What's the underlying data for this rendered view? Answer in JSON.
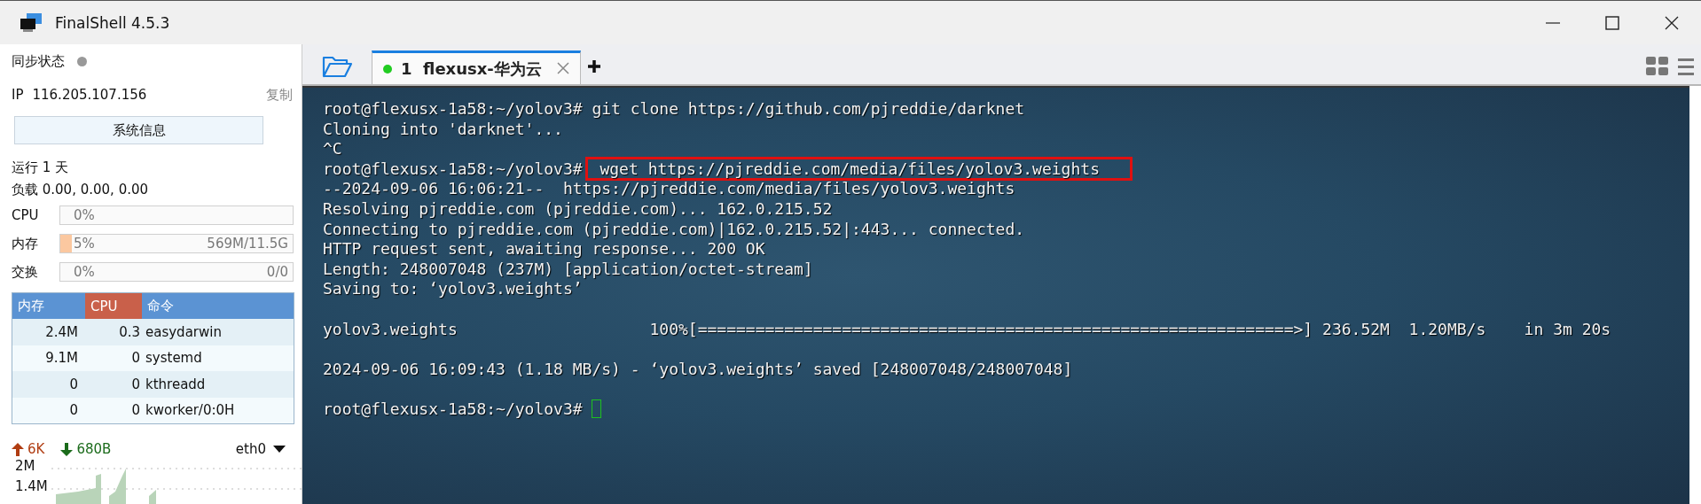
{
  "window": {
    "title": "FinalShell 4.5.3"
  },
  "sidebar": {
    "sync_label": "同步状态",
    "ip_label": "IP",
    "ip": "116.205.107.156",
    "copy_link": "复制",
    "sysinfo_button": "系统信息",
    "uptime": "运行 1 天",
    "load": "负载 0.00, 0.00, 0.00",
    "meters": [
      {
        "label": "CPU",
        "reading": "0%",
        "level": 0
      },
      {
        "label": "内存",
        "reading": "5%",
        "detail": "569M/11.5G",
        "level": 0.05
      },
      {
        "label": "交换",
        "reading": "0%",
        "detail": "0/0",
        "level": 0
      }
    ],
    "process_table": {
      "columns": [
        {
          "label": "内存",
          "selected": false
        },
        {
          "label": "CPU",
          "selected": true
        },
        {
          "label": "命令",
          "selected": false
        }
      ],
      "rows": [
        {
          "mem": "2.4M",
          "cpu": "0.3",
          "command": "easydarwin"
        },
        {
          "mem": "9.1M",
          "cpu": "0",
          "command": "systemd"
        },
        {
          "mem": "0",
          "cpu": "0",
          "command": "kthreadd"
        },
        {
          "mem": "0",
          "cpu": "0",
          "command": "kworker/0:0H"
        }
      ]
    },
    "network": {
      "upload": "6K",
      "download": "680B",
      "interface": "eth0",
      "axis_labels": [
        "2M",
        "1.4M"
      ]
    }
  },
  "tabs": [
    {
      "label": "1  flexusx-华为云",
      "connected": true,
      "selected": true
    }
  ],
  "terminal": {
    "lines": [
      {
        "kind": "text",
        "text": "root@flexusx-1a58:~/yolov3# git clone https://github.com/pjreddie/darknet"
      },
      {
        "kind": "text",
        "text": "Cloning into 'darknet'..."
      },
      {
        "kind": "text",
        "text": "^C"
      },
      {
        "kind": "marked",
        "text": "root@flexusx-1a58:~/yolov3#",
        "marked_text": " wget https://pjreddie.com/media/files/yolov3.weights"
      },
      {
        "kind": "text",
        "text": "--2024-09-06 16:06:21--  https://pjreddie.com/media/files/yolov3.weights"
      },
      {
        "kind": "text",
        "text": "Resolving pjreddie.com (pjreddie.com)... 162.0.215.52"
      },
      {
        "kind": "text",
        "text": "Connecting to pjreddie.com (pjreddie.com)|162.0.215.52|:443... connected."
      },
      {
        "kind": "text",
        "text": "HTTP request sent, awaiting response... 200 OK"
      },
      {
        "kind": "text",
        "text": "Length: 248007048 (237M) [application/octet-stream]"
      },
      {
        "kind": "text",
        "text": "Saving to: ‘yolov3.weights’"
      },
      {
        "kind": "blank"
      },
      {
        "kind": "text",
        "text": "yolov3.weights                    100%[==============================================================>] 236.52M  1.20MB/s    in 3m 20s"
      },
      {
        "kind": "blank"
      },
      {
        "kind": "text",
        "text": "2024-09-06 16:09:43 (1.18 MB/s) - ‘yolov3.weights’ saved [248007048/248007048]"
      },
      {
        "kind": "blank"
      },
      {
        "kind": "prompt",
        "text": "root@flexusx-1a58:~/yolov3#",
        "cursor": true
      }
    ]
  }
}
